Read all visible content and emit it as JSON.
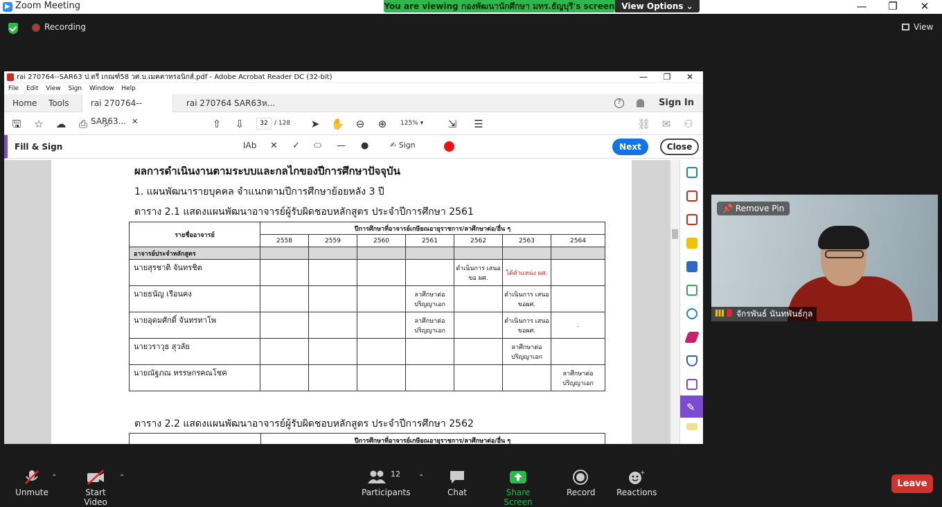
{
  "zoom": {
    "window_title": "Zoom Meeting",
    "banner_text": "You are viewing กองพัฒนานักศึกษา มทร.ธัญบุรี's screen",
    "view_options": "View Options ⌄",
    "recording": "Recording",
    "view": "View",
    "remove_pin": "Remove Pin",
    "participant_name": "จักรพันธ์ นันทพันธ์กุล",
    "participant_count": "12",
    "toolbar": {
      "unmute": "Unmute",
      "start_video": "Start Video",
      "participants": "Participants",
      "chat": "Chat",
      "share_screen": "Share Screen",
      "record": "Record",
      "reactions": "Reactions",
      "leave": "Leave"
    },
    "colors": {
      "share_green": "#2eb84b",
      "leave_red": "#d0312d",
      "bg": "#1a1a1a"
    }
  },
  "acrobat": {
    "title": "rai 270764--SAR63 ป.ตรี เกณฑ์58 วศ.บ.เมคคาทรอนิกส์.pdf - Adobe Acrobat Reader DC (32-bit)",
    "menu": [
      "File",
      "Edit",
      "View",
      "Sign",
      "Window",
      "Help"
    ],
    "tabs": {
      "home": "Home",
      "tools": "Tools",
      "doc1": "rai 270764--SAR63...",
      "doc2": "rai 270764 SAR63ห..."
    },
    "sign_in": "Sign In",
    "page_current": "32",
    "page_total": "/ 128",
    "zoom": "125%",
    "fill_sign": "Fill & Sign",
    "text_tool": "IAb",
    "sign": "Sign",
    "next": "Next",
    "close": "Close"
  },
  "document": {
    "heading": "ผลการดำเนินงานตามระบบและกลไกของปีการศึกษาปัจจุบัน",
    "subheading": "1.  แผนพัฒนารายบุคคล จำแนกตามปีการศึกษาย้อยหลัง 3 ปี",
    "table_title": "ตาราง 2.1 แสดงแผนพัฒนาอาจารย์ผู้รับผิดชอบหลักสูตร ประจำปีการศึกษา 2561",
    "table_title_2": "ตาราง 2.2 แสดงแผนพัฒนาอาจารย์ผู้รับผิดชอบหลักสูตร ประจำปีการศึกษา 2562",
    "col_name": "รายชื่ออาจารย์",
    "col_group": "ปีการศึกษาที่อาจารย์เกษียณอายุราชการ/ลาศึกษาต่อ/อื่น ๆ",
    "years": [
      "2558",
      "2559",
      "2560",
      "2561",
      "2562",
      "2563",
      "2564"
    ],
    "group_row": "อาจารย์ประจำหลักสูตร",
    "rows": [
      {
        "name": "นายสุรชาติ จันทรชิต",
        "cells": [
          "",
          "",
          "",
          "",
          "ดำเนินการ เสนอขอ ผศ.",
          "ได้ตำแหน่ง ผศ.",
          ""
        ]
      },
      {
        "name": "นายธนัญ เรือนคง",
        "cells": [
          "",
          "",
          "",
          "ลาศึกษาต่อ ปริญญาเอก",
          "",
          "ดำเนินการ เสนอขอผศ.",
          ""
        ]
      },
      {
        "name": "นายอุดมศักดิ์ จันทรทาโพ",
        "cells": [
          "",
          "",
          "",
          "ลาศึกษาต่อ ปริญญาเอก",
          "",
          "ดำเนินการ เสนอขอผศ.",
          "."
        ]
      },
      {
        "name": "นายวราวุธ สุวลัย",
        "cells": [
          "",
          "",
          "",
          "",
          "",
          "ลาศึกษาต่อ ปริญญาเอก",
          ""
        ]
      },
      {
        "name": "นายณัฐภณ หรรษกรคณโชค",
        "cells": [
          "",
          "",
          "",
          "",
          "",
          "",
          "ลาศึกษาต่อ ปริญญาเอก"
        ]
      }
    ]
  }
}
